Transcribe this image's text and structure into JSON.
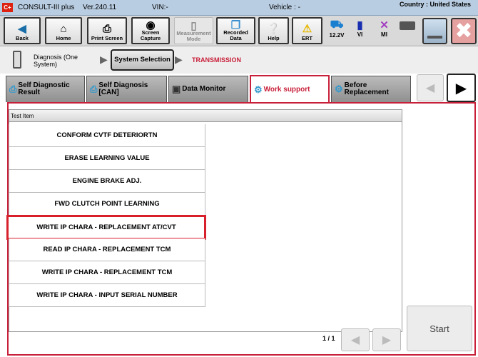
{
  "title": {
    "app": "CONSULT-III plus",
    "version": "Ver.240.11",
    "vin": "VIN:-",
    "vehicle": "Vehicle : -",
    "country": "Country : United States",
    "logo": "C+"
  },
  "toolbar": {
    "back": "Back",
    "home": "Home",
    "print": "Print Screen",
    "capture": "Screen Capture",
    "measurement": "Measurement Mode",
    "recorded": "Recorded Data",
    "help": "Help",
    "ert": "ERT",
    "voltage": "12.2V",
    "vi": "VI",
    "mi": "MI"
  },
  "breadcrumb": {
    "step1": "Diagnosis (One System)",
    "step2": "System Selection",
    "current": "TRANSMISSION"
  },
  "tabs": [
    {
      "label": "Self Diagnostic Result"
    },
    {
      "label": "Self Diagnosis [CAN]"
    },
    {
      "label": "Data Monitor"
    },
    {
      "label": "Work support"
    },
    {
      "label": "Before Replacement"
    }
  ],
  "table": {
    "header": "Test Item",
    "rows": [
      "CONFORM CVTF DETERIORTN",
      "ERASE LEARNING VALUE",
      "ENGINE BRAKE ADJ.",
      "FWD CLUTCH POINT LEARNING",
      "WRITE IP CHARA - REPLACEMENT AT/CVT",
      "READ IP CHARA - REPLACEMENT TCM",
      "WRITE IP CHARA - REPLACEMENT TCM",
      "WRITE IP CHARA - INPUT SERIAL NUMBER"
    ],
    "selected_index": 4
  },
  "pager": {
    "label": "1 / 1"
  },
  "start": "Start",
  "colors": {
    "accent": "#c8203a",
    "titlebar": "#b9cde2"
  }
}
